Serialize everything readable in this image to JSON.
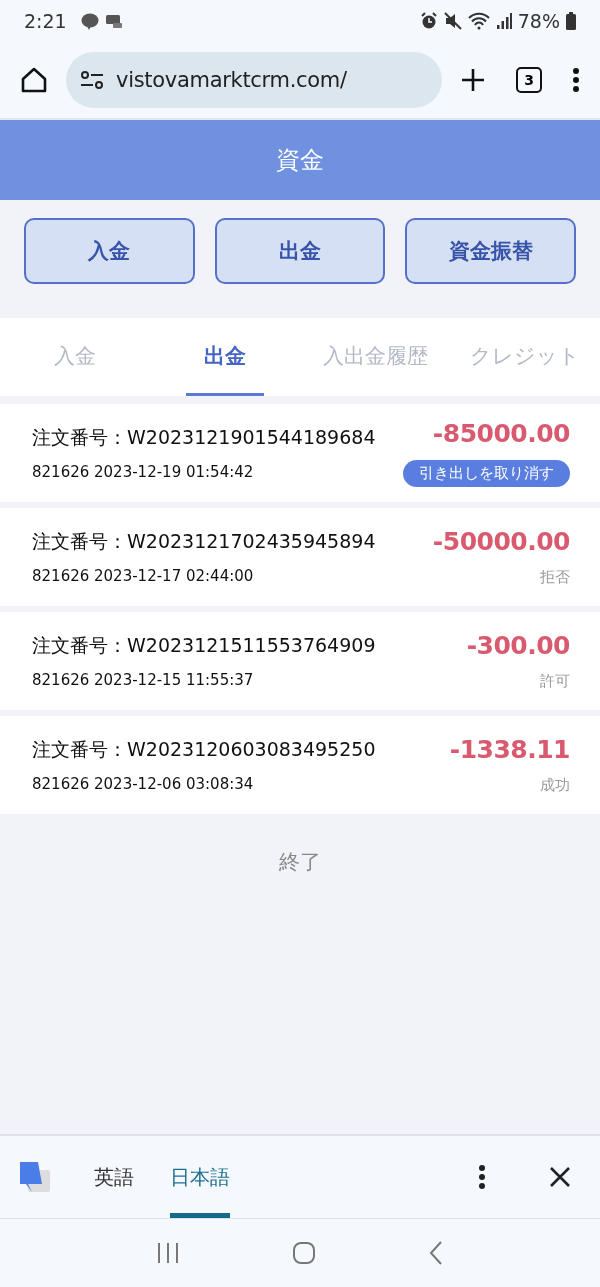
{
  "status_bar": {
    "time": "2:21",
    "battery": "78%"
  },
  "browser": {
    "url": "vistovamarktcrm.com/",
    "tab_count": "3"
  },
  "header": {
    "title": "資金"
  },
  "actions": [
    "入金",
    "出金",
    "資金振替"
  ],
  "tabs": [
    {
      "label": "入金",
      "selected": false
    },
    {
      "label": "出金",
      "selected": true
    },
    {
      "label": "入出金履歴",
      "selected": false
    },
    {
      "label": "クレジット",
      "selected": false
    }
  ],
  "orders": [
    {
      "order": "注文番号：W2023121901544189684",
      "meta": "821626 2023-12-19 01:54:42",
      "amount": "-85000.00",
      "kind": "button",
      "status": "引き出しを取り消す"
    },
    {
      "order": "注文番号：W2023121702435945894",
      "meta": "821626 2023-12-17 02:44:00",
      "amount": "-50000.00",
      "kind": "status",
      "status": "拒否"
    },
    {
      "order": "注文番号：W2023121511553764909",
      "meta": "821626 2023-12-15 11:55:37",
      "amount": "-300.00",
      "kind": "status",
      "status": "許可"
    },
    {
      "order": "注文番号：W2023120603083495250",
      "meta": "821626 2023-12-06 03:08:34",
      "amount": "-1338.11",
      "kind": "status",
      "status": "成功"
    }
  ],
  "end_text": "終了",
  "translate_bar": {
    "languages": [
      {
        "label": "英語",
        "selected": false
      },
      {
        "label": "日本語",
        "selected": true
      }
    ]
  }
}
